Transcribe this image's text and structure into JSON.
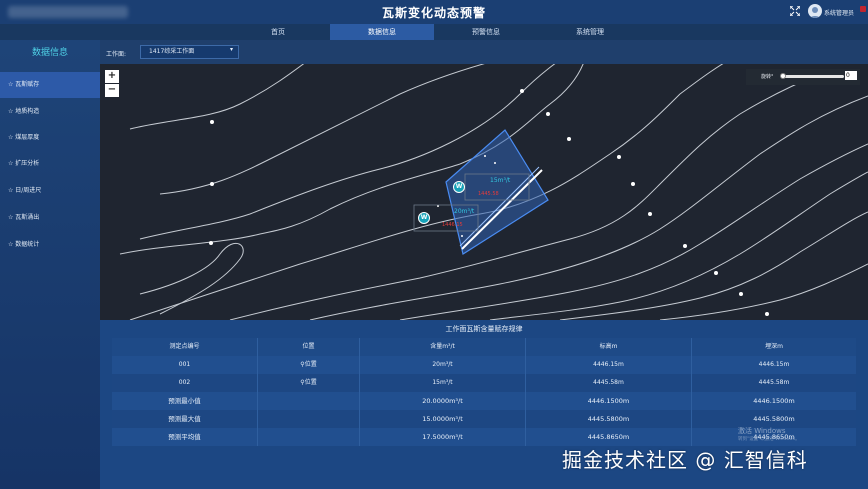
{
  "header": {
    "title": "瓦斯变化动态预警",
    "user_name": "系统管理员"
  },
  "nav": {
    "tabs": [
      {
        "label": "首页",
        "active": false
      },
      {
        "label": "数据信息",
        "active": true
      },
      {
        "label": "预警信息",
        "active": false
      },
      {
        "label": "系统管理",
        "active": false
      }
    ]
  },
  "sidebar": {
    "title": "数据信息",
    "items": [
      {
        "label": "☆ 瓦斯赋存",
        "active": true
      },
      {
        "label": "☆ 地质构造",
        "active": false
      },
      {
        "label": "☆ 煤层厚度",
        "active": false
      },
      {
        "label": "☆ 扩压分析",
        "active": false
      },
      {
        "label": "☆ 日/周进尺",
        "active": false
      },
      {
        "label": "☆ 瓦斯涌出",
        "active": false
      },
      {
        "label": "☆ 数据统计",
        "active": false
      }
    ]
  },
  "toolbar": {
    "filter_label": "工作面:",
    "selected_workface": "1417综采工作面"
  },
  "map": {
    "zoom_in": "+",
    "zoom_out": "−",
    "rotate_label": "旋转°",
    "rotate_value": "0",
    "rotate_fraction": 0.0,
    "markers": [
      {
        "icon": "W",
        "label": "15m³/t",
        "sub": "1445.58"
      },
      {
        "icon": "W",
        "label": "20m³/t",
        "sub": "1446.15"
      }
    ]
  },
  "table": {
    "title": "工作面瓦斯含量赋存规律",
    "headers": [
      "测定点编号",
      "位置",
      "含量m³/t",
      "标高m",
      "埋深m"
    ],
    "rows": [
      [
        "001",
        "位置",
        "20m³/t",
        "4446.15m",
        "4446.15m"
      ],
      [
        "002",
        "位置",
        "15m³/t",
        "4445.58m",
        "4445.58m"
      ]
    ],
    "stats": [
      [
        "预测最小值",
        "",
        "20.0000m³/t",
        "4446.1500m",
        "4446.1500m"
      ],
      [
        "预测最大值",
        "",
        "15.0000m³/t",
        "4445.5800m",
        "4445.5800m"
      ],
      [
        "预测平均值",
        "",
        "17.5000m³/t",
        "4445.8650m",
        "4445.8650m"
      ]
    ]
  },
  "overlay": {
    "activate_windows": "激活 Windows",
    "activate_sub": "转到\"设置\"以激活 Windows。",
    "watermark": "掘金技术社区 @ 汇智信科"
  },
  "colors": {
    "header_bg": "#1b3f73",
    "nav_active": "#2c5ba3",
    "sidebar_title": "#4fd1e6",
    "map_bg": "#1f2530",
    "panel_bg": "#1c4783",
    "marker_teal": "#17a2b8",
    "marker_red": "#e23b3b",
    "polygon_blue": "#3b7fe0"
  }
}
